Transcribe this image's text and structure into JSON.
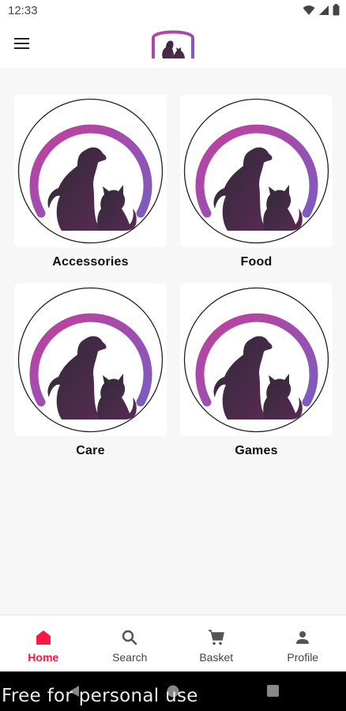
{
  "status_bar": {
    "time": "12:33",
    "icons": [
      "wifi-icon",
      "signal-icon",
      "battery-icon"
    ]
  },
  "app_bar": {
    "menu_icon": "hamburger-menu-icon",
    "logo": "pet-shop-logo"
  },
  "categories": [
    {
      "label": "Accessories",
      "image": "dog-and-cat-logo"
    },
    {
      "label": "Food",
      "image": "dog-and-cat-logo"
    },
    {
      "label": "Care",
      "image": "dog-and-cat-logo"
    },
    {
      "label": "Games",
      "image": "dog-and-cat-logo"
    }
  ],
  "bottom_nav": {
    "items": [
      {
        "label": "Home",
        "icon": "home-icon",
        "active": true
      },
      {
        "label": "Search",
        "icon": "search-icon",
        "active": false
      },
      {
        "label": "Basket",
        "icon": "cart-icon",
        "active": false
      },
      {
        "label": "Profile",
        "icon": "person-icon",
        "active": false
      }
    ]
  },
  "system_nav": {
    "buttons": [
      "back-icon",
      "home-circle-icon",
      "recents-icon"
    ]
  },
  "watermark": "Free for personal use",
  "colors": {
    "accent": "#ff1744",
    "logo_gradient_start": "#c2409c",
    "logo_gradient_end": "#7b5cc0",
    "silhouette": "#3a2a40"
  }
}
